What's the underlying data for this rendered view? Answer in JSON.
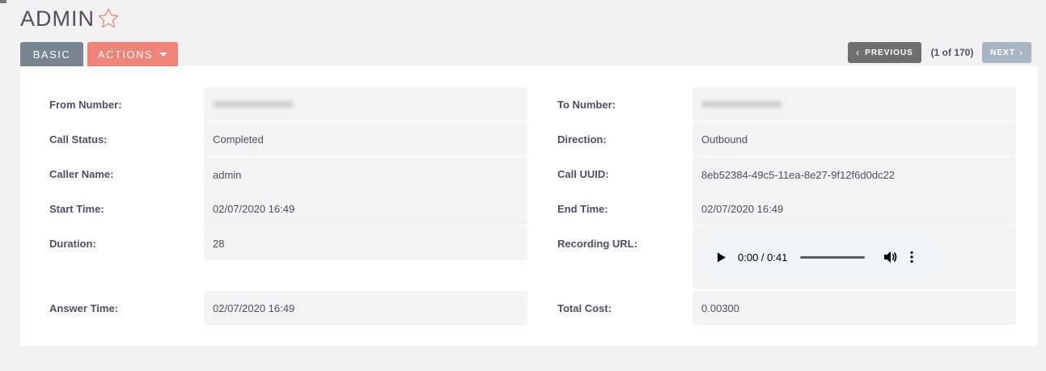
{
  "header": {
    "title": "ADMIN",
    "favorite_icon": "star-outline-icon",
    "star_color": "#f08377"
  },
  "tabs": {
    "basic_label": "BASIC",
    "actions_label": "ACTIONS"
  },
  "pager": {
    "previous_label": "PREVIOUS",
    "count": "(1 of 170)",
    "next_label": "NEXT"
  },
  "colors": {
    "basic_tab": "#778591",
    "actions_tab": "#f08377",
    "previous_button": "#6f6f6f",
    "next_button": "#a7b6c2"
  },
  "fields": {
    "from_number": {
      "label": "From Number:",
      "value": ""
    },
    "to_number": {
      "label": "To Number:",
      "value": ""
    },
    "call_status": {
      "label": "Call Status:",
      "value": "Completed"
    },
    "direction": {
      "label": "Direction:",
      "value": "Outbound"
    },
    "caller_name": {
      "label": "Caller Name:",
      "value": "admin"
    },
    "call_uuid": {
      "label": "Call UUID:",
      "value": "8eb52384-49c5-11ea-8e27-9f12f6d0dc22"
    },
    "start_time": {
      "label": "Start Time:",
      "value": "02/07/2020 16:49"
    },
    "end_time": {
      "label": "End Time:",
      "value": "02/07/2020 16:49"
    },
    "duration": {
      "label": "Duration:",
      "value": "28"
    },
    "recording_url": {
      "label": "Recording URL:"
    },
    "answer_time": {
      "label": "Answer Time:",
      "value": "02/07/2020 16:49"
    },
    "total_cost": {
      "label": "Total Cost:",
      "value": "0.00300"
    }
  },
  "audio": {
    "time": "0:00 / 0:41",
    "progress": 0,
    "icons": [
      "play-icon",
      "volume-icon",
      "more-options-icon"
    ]
  }
}
